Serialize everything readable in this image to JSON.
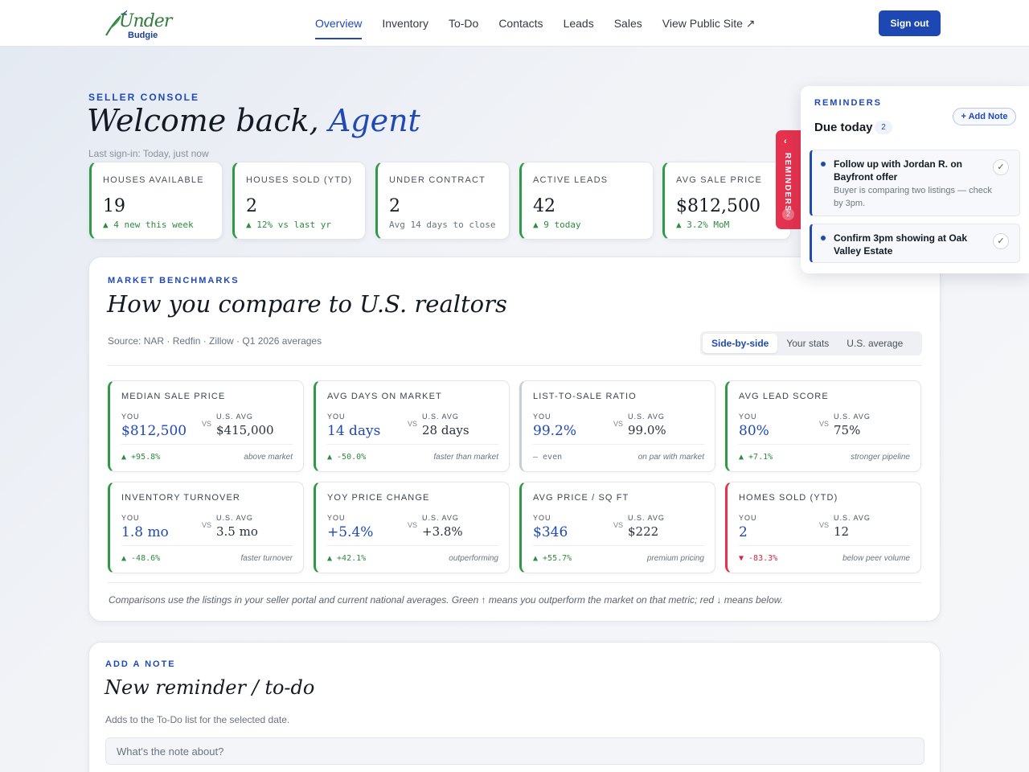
{
  "brand": {
    "line1": "Under",
    "line2": "Budgie"
  },
  "nav": {
    "items": [
      {
        "label": "Overview",
        "active": true
      },
      {
        "label": "Inventory",
        "active": false
      },
      {
        "label": "To-Do",
        "active": false
      },
      {
        "label": "Contacts",
        "active": false
      },
      {
        "label": "Leads",
        "active": false
      },
      {
        "label": "Sales",
        "active": false
      },
      {
        "label": "View Public Site ↗",
        "active": false
      }
    ],
    "signout_label": "Sign out"
  },
  "hero": {
    "eyebrow": "SELLER CONSOLE",
    "title": "Welcome back,",
    "title_accent": "Agent",
    "last_signin": "Last sign-in: Today, just now"
  },
  "stats": [
    {
      "label": "HOUSES AVAILABLE",
      "value": "19",
      "change": "▲ 4 new this week"
    },
    {
      "label": "HOUSES SOLD (YTD)",
      "value": "2",
      "change": "▲ 12% vs last yr"
    },
    {
      "label": "UNDER CONTRACT",
      "value": "2",
      "change": "Avg 14 days to close"
    },
    {
      "label": "ACTIVE LEADS",
      "value": "42",
      "change": "▲ 9 today"
    },
    {
      "label": "AVG SALE PRICE",
      "value": "$812,500",
      "change": "▲ 3.2% MoM"
    }
  ],
  "reminders": {
    "tab_label": "REMINDERS",
    "tab_count": "2",
    "eyebrow": "REMINDERS",
    "due_label": "Due today",
    "due_count": "2",
    "add_label": "+ Add Note",
    "items": [
      {
        "title": "Follow up with Jordan R. on Bayfront offer",
        "detail": "Buyer is comparing two listings — check by 3pm."
      },
      {
        "title": "Confirm 3pm showing at Oak Valley Estate",
        "detail": ""
      }
    ]
  },
  "benchmarks": {
    "eyebrow": "MARKET BENCHMARKS",
    "title": "How you compare to U.S. realtors",
    "source": "Source: NAR · Redfin · Zillow · Q1 2026 averages",
    "segments": [
      {
        "label": "Side-by-side",
        "active": true
      },
      {
        "label": "Your stats",
        "active": false
      },
      {
        "label": "U.S. average",
        "active": false
      }
    ],
    "you_label": "YOU",
    "vs_label": "VS",
    "us_label": "U.S. AVG",
    "cards": [
      {
        "label": "MEDIAN SALE PRICE",
        "you": "$812,500",
        "us": "$415,000",
        "delta": "▲ +95.8%",
        "note": "above market",
        "tone": "green"
      },
      {
        "label": "AVG DAYS ON MARKET",
        "you": "14 days",
        "us": "28 days",
        "delta": "▲ -50.0%",
        "note": "faster than market",
        "tone": "green"
      },
      {
        "label": "LIST-TO-SALE RATIO",
        "you": "99.2%",
        "us": "99.0%",
        "delta": "– even",
        "note": "on par with market",
        "tone": "gray"
      },
      {
        "label": "AVG LEAD SCORE",
        "you": "80%",
        "us": "75%",
        "delta": "▲ +7.1%",
        "note": "stronger pipeline",
        "tone": "green"
      },
      {
        "label": "INVENTORY TURNOVER",
        "you": "1.8 mo",
        "us": "3.5 mo",
        "delta": "▲ -48.6%",
        "note": "faster turnover",
        "tone": "green"
      },
      {
        "label": "YOY PRICE CHANGE",
        "you": "+5.4%",
        "us": "+3.8%",
        "delta": "▲ +42.1%",
        "note": "outperforming",
        "tone": "green"
      },
      {
        "label": "AVG PRICE / SQ FT",
        "you": "$346",
        "us": "$222",
        "delta": "▲ +55.7%",
        "note": "premium pricing",
        "tone": "green"
      },
      {
        "label": "HOMES SOLD (YTD)",
        "you": "2",
        "us": "12",
        "delta": "▼ -83.3%",
        "note": "below peer volume",
        "tone": "red"
      }
    ],
    "footnote": "Comparisons use the listings in your seller portal and current national averages. Green ↑ means you outperform the market on that metric; red ↓ means below."
  },
  "note_form": {
    "eyebrow": "ADD A NOTE",
    "title": "New reminder / to-do",
    "subtitle": "Adds to the To-Do list for the selected date.",
    "placeholder": "What's the note about?"
  },
  "colors": {
    "accent": "#1f49b6",
    "positive": "#2e9a47",
    "negative": "#e5324f"
  }
}
